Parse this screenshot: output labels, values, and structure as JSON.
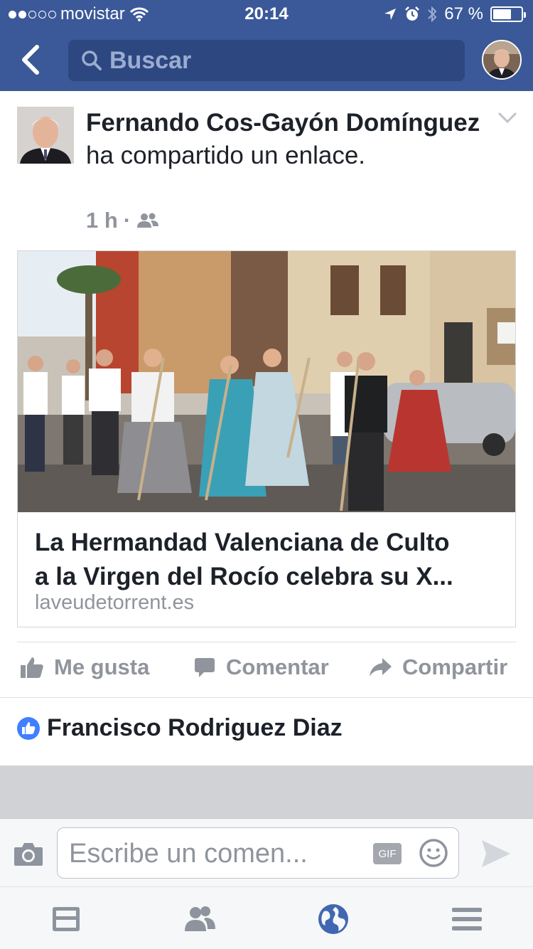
{
  "status_bar": {
    "carrier": "movistar",
    "time": "20:14",
    "battery": "67 %",
    "battery_level": 0.67,
    "signal_dots_filled": 2,
    "signal_dots_total": 5
  },
  "nav": {
    "search_placeholder": "Buscar"
  },
  "post": {
    "author": "Fernando Cos-Gayón Domínguez",
    "action": " ha compartido un enlace.",
    "time": "1 h",
    "separator": "·",
    "audience_icon": "friends-icon"
  },
  "link_card": {
    "title_line1": "La Hermandad Valenciana de Culto",
    "title_line2": "a la Virgen del Rocío celebra su X...",
    "domain": "laveudetorrent.es"
  },
  "actions": {
    "like": "Me gusta",
    "comment": "Comentar",
    "share": "Compartir"
  },
  "likes": {
    "name": "Francisco Rodriguez Diaz"
  },
  "composer": {
    "placeholder": "Escribe un comen...",
    "gif_label": "GIF"
  },
  "colors": {
    "brand": "#3b5998",
    "search_bg": "#2d4780",
    "muted_text": "#90949c",
    "like_blue": "#4080ff",
    "active_tab": "#4267b2"
  },
  "tabs": [
    "news-feed-icon",
    "friends-icon",
    "globe-notifications-icon",
    "menu-icon"
  ]
}
